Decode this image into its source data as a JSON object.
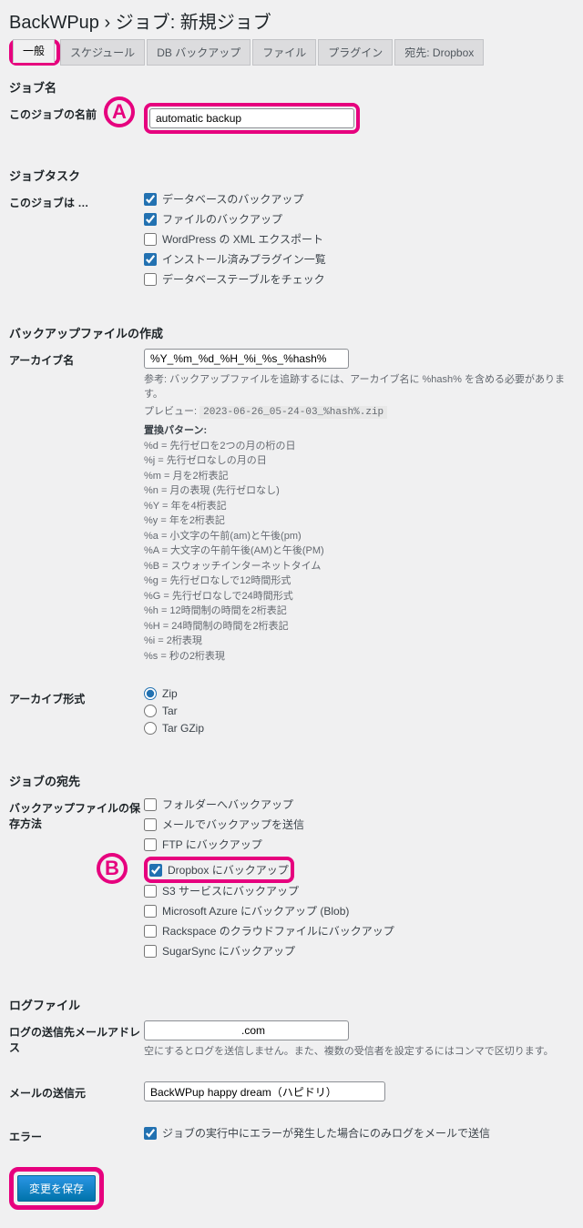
{
  "header": {
    "title": "BackWPup › ジョブ: 新規ジョブ"
  },
  "tabs": [
    {
      "label": "一般",
      "active": true
    },
    {
      "label": "スケジュール",
      "active": false
    },
    {
      "label": "DB バックアップ",
      "active": false
    },
    {
      "label": "ファイル",
      "active": false
    },
    {
      "label": "プラグイン",
      "active": false
    },
    {
      "label": "宛先: Dropbox",
      "active": false
    }
  ],
  "annotations": {
    "a": "A",
    "b": "B"
  },
  "sections": {
    "jobName": {
      "heading": "ジョブ名",
      "label": "このジョブの名前",
      "value": "automatic backup"
    },
    "jobTask": {
      "heading": "ジョブタスク",
      "label": "このジョブは …",
      "items": [
        {
          "label": "データベースのバックアップ",
          "checked": true
        },
        {
          "label": "ファイルのバックアップ",
          "checked": true
        },
        {
          "label": "WordPress の XML エクスポート",
          "checked": false
        },
        {
          "label": "インストール済みプラグイン一覧",
          "checked": true
        },
        {
          "label": "データベーステーブルをチェック",
          "checked": false
        }
      ]
    },
    "backupFile": {
      "heading": "バックアップファイルの作成",
      "archiveNameLabel": "アーカイブ名",
      "archiveNameValue": "%Y_%m_%d_%H_%i_%s_%hash%",
      "hashNote": "参考: バックアップファイルを追跡するには、アーカイブ名に %hash% を含める必要があります。",
      "previewLabel": "プレビュー:",
      "previewValue": "2023-06-26_05-24-03_%hash%.zip",
      "patternsTitle": "置換パターン:",
      "patterns": [
        "%d = 先行ゼロを2つの月の桁の日",
        "%j = 先行ゼロなしの月の日",
        "%m = 月を2桁表記",
        "%n = 月の表現 (先行ゼロなし)",
        "%Y = 年を4桁表記",
        "%y = 年を2桁表記",
        "%a = 小文字の午前(am)と午後(pm)",
        "%A = 大文字の午前午後(AM)と午後(PM)",
        "%B = スウォッチインターネットタイム",
        "%g = 先行ゼロなしで12時間形式",
        "%G = 先行ゼロなしで24時間形式",
        "%h = 12時間制の時間を2桁表記",
        "%H = 24時間制の時間を2桁表記",
        "%i = 2桁表現",
        "%s = 秒の2桁表現"
      ],
      "archiveFormatLabel": "アーカイブ形式",
      "formats": [
        {
          "label": "Zip",
          "checked": true
        },
        {
          "label": "Tar",
          "checked": false
        },
        {
          "label": "Tar GZip",
          "checked": false
        }
      ]
    },
    "destination": {
      "heading": "ジョブの宛先",
      "label": "バックアップファイルの保存方法",
      "items": [
        {
          "label": "フォルダーへバックアップ",
          "checked": false
        },
        {
          "label": "メールでバックアップを送信",
          "checked": false
        },
        {
          "label": "FTP にバックアップ",
          "checked": false
        },
        {
          "label": "Dropbox にバックアップ",
          "checked": true,
          "highlight": true
        },
        {
          "label": "S3 サービスにバックアップ",
          "checked": false
        },
        {
          "label": "Microsoft Azure にバックアップ (Blob)",
          "checked": false
        },
        {
          "label": "Rackspace のクラウドファイルにバックアップ",
          "checked": false
        },
        {
          "label": "SugarSync にバックアップ",
          "checked": false
        }
      ]
    },
    "logFile": {
      "heading": "ログファイル",
      "emailLabel": "ログの送信先メールアドレス",
      "emailValue": "                              .com",
      "emailNote": "空にするとログを送信しません。また、複数の受信者を設定するにはコンマで区切ります。",
      "senderLabel": "メールの送信元",
      "senderValue": "BackWPup happy dream（ハピドリ）",
      "errorLabel": "エラー",
      "errorCheckLabel": "ジョブの実行中にエラーが発生した場合にのみログをメールで送信"
    }
  },
  "submit": {
    "label": "変更を保存"
  }
}
